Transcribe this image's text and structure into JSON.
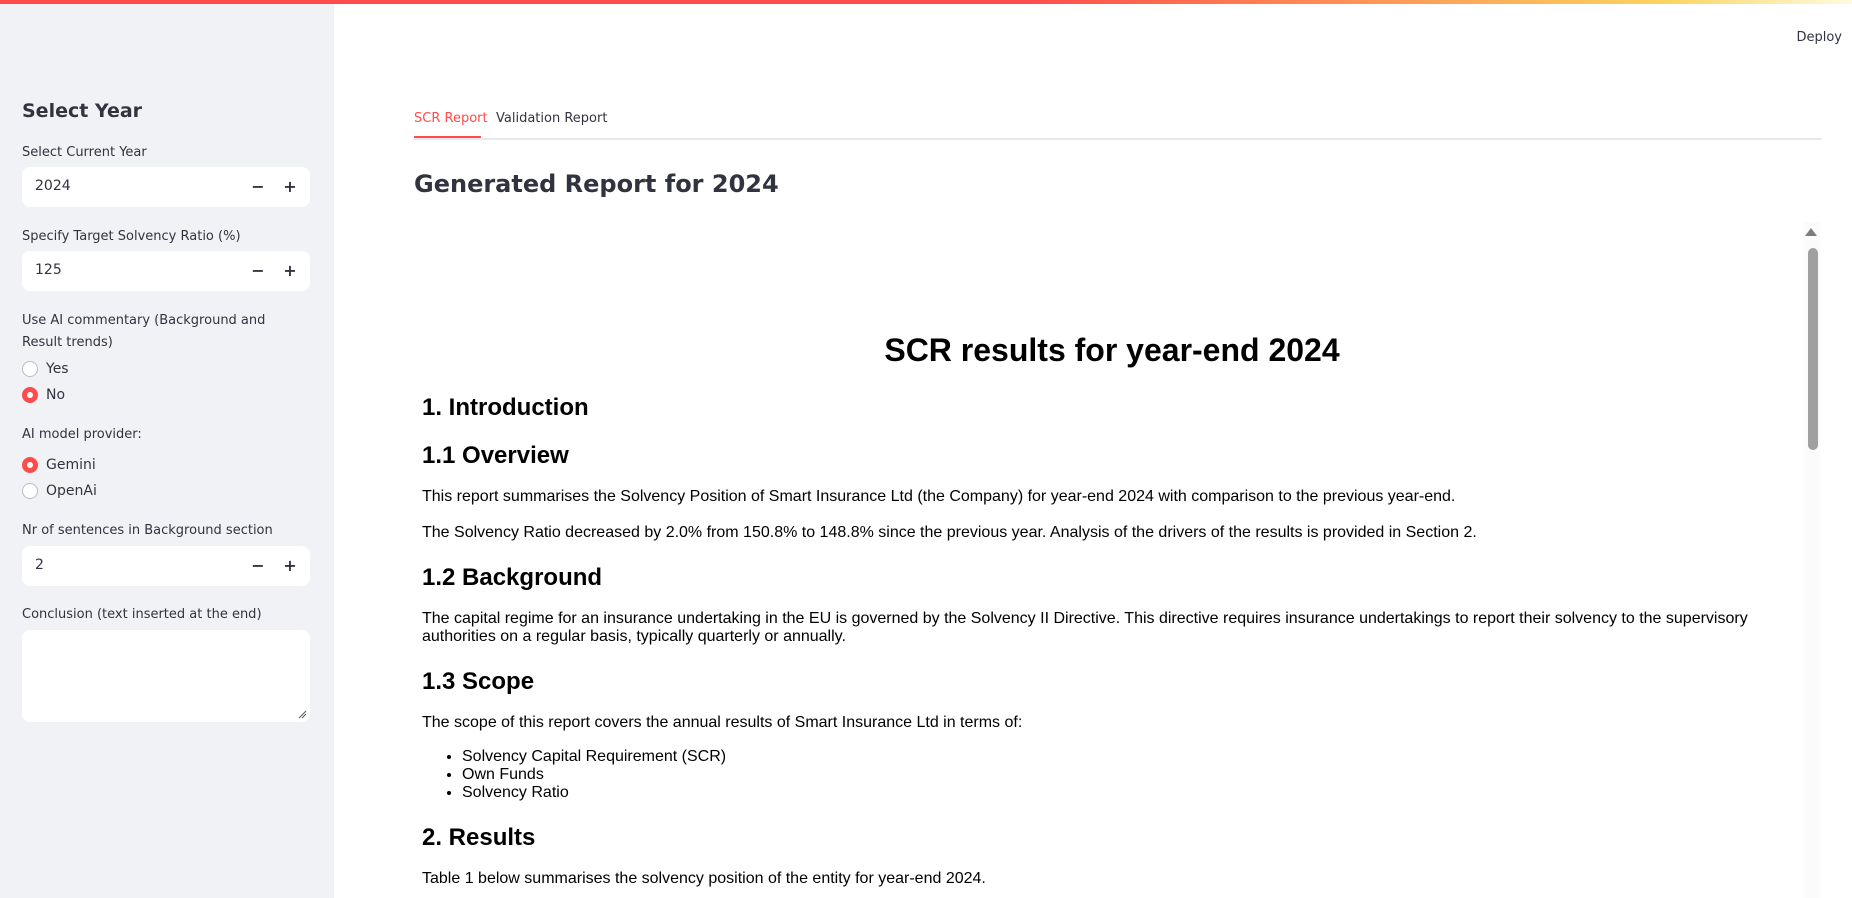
{
  "sidebar": {
    "section_title": "Select Year",
    "year": {
      "label": "Select Current Year",
      "value": "2024"
    },
    "target_ratio": {
      "label": "Specify Target Solvency Ratio (%)",
      "value": "125"
    },
    "ai_commentary": {
      "label": "Use AI commentary (Background and Result trends)",
      "options": [
        "Yes",
        "No"
      ],
      "selected": "No"
    },
    "ai_provider": {
      "label": "AI model provider:",
      "options": [
        "Gemini",
        "OpenAi"
      ],
      "selected": "Gemini"
    },
    "sentences": {
      "label": "Nr of sentences in Background section",
      "value": "2"
    },
    "conclusion": {
      "label": "Conclusion (text inserted at the end)",
      "value": ""
    },
    "minus_symbol": "−",
    "plus_symbol": "+"
  },
  "header": {
    "deploy_label": "Deploy"
  },
  "tabs": [
    {
      "label": "SCR Report",
      "active": true
    },
    {
      "label": "Validation Report",
      "active": false
    }
  ],
  "main": {
    "title": "Generated Report for 2024"
  },
  "report": {
    "title": "SCR results for year-end 2024",
    "intro_heading": "1. Introduction",
    "overview_heading": "1.1 Overview",
    "overview_p1": "This report summarises the Solvency Position of Smart Insurance Ltd (the Company) for year-end 2024 with comparison to the previous year-end.",
    "overview_p2": "The Solvency Ratio decreased by 2.0% from 150.8% to 148.8% since the previous year. Analysis of the drivers of the results is provided in Section 2.",
    "background_heading": "1.2 Background",
    "background_p": "The capital regime for an insurance undertaking in the EU is governed by the Solvency II Directive. This directive requires insurance undertakings to report their solvency to the supervisory authorities on a regular basis, typically quarterly or annually.",
    "scope_heading": "1.3 Scope",
    "scope_p": "The scope of this report covers the annual results of Smart Insurance Ltd in terms of:",
    "scope_items": [
      "Solvency Capital Requirement (SCR)",
      "Own Funds",
      "Solvency Ratio"
    ],
    "results_heading": "2. Results",
    "results_p": "Table 1 below summarises the solvency position of the entity for year-end 2024."
  },
  "colors": {
    "accent": "#ff4b4b",
    "sidebar_bg": "#f0f2f6",
    "text": "#31333f"
  }
}
